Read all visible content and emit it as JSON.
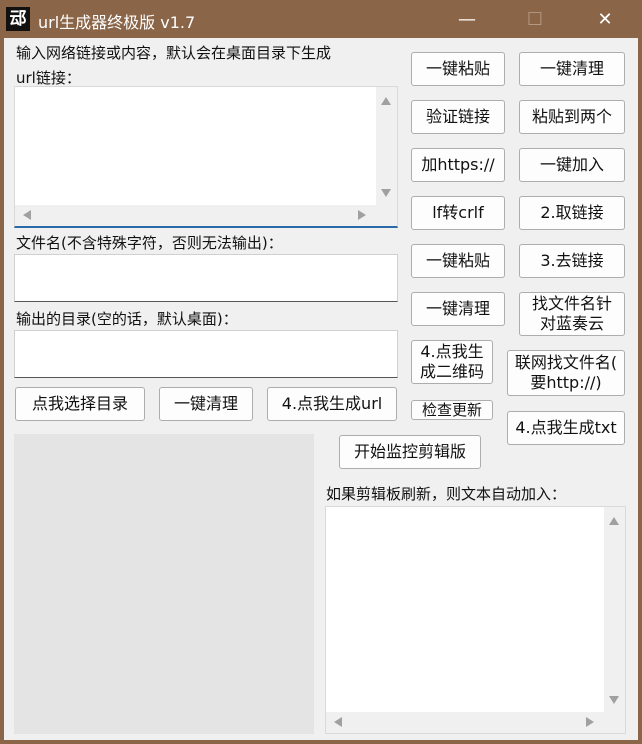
{
  "window": {
    "title": "url生成器终极版 v1.7",
    "icon_glyph": "䢵",
    "minimize_glyph": "—",
    "maximize_glyph": "☐",
    "close_glyph": "✕"
  },
  "left": {
    "input_label": "输入网络链接或内容，默认会在桌面目录下生成\nurl链接：",
    "input_label_line1": "输入网络链接或内容，默认会在桌面目录下生成",
    "input_label_line2": "url链接：",
    "input_value": "",
    "filename_label": "文件名(不含特殊字符，否则无法输出)：",
    "filename_value": "",
    "outdir_label": "输出的目录(空的话，默认桌面)：",
    "outdir_value": "",
    "btn_choose_dir": "点我选择目录",
    "btn_clear": "一键清理",
    "btn_gen_url": "4.点我生成url"
  },
  "right": {
    "col1": [
      "一键粘贴",
      "验证链接",
      "加https://",
      "lf转crlf",
      "一键粘贴",
      "一键清理"
    ],
    "col2": [
      "一键清理",
      "粘贴到两个",
      "一键加入",
      "2.取链接",
      "3.去链接"
    ],
    "btn_find_filename": "找文件名针对蓝奏云",
    "btn_find_filename_l1": "找文件名针",
    "btn_find_filename_l2": "对蓝奏云",
    "btn_qrcode_l1": "4.点我生",
    "btn_qrcode_l2": "成二维码",
    "btn_online_find_l1": "联网找文件名(",
    "btn_online_find_l2": "要http://)",
    "btn_check_update": "检查更新",
    "btn_gen_txt": "4.点我生成txt",
    "btn_start_monitor": "开始监控剪辑版",
    "clipboard_label": "如果剪辑板刷新，则文本自动加入：",
    "clipboard_value": ""
  },
  "colors": {
    "titlebar": "#8a6548",
    "client_bg": "#f0f0f0",
    "panel_gray": "#e4e4e4"
  }
}
